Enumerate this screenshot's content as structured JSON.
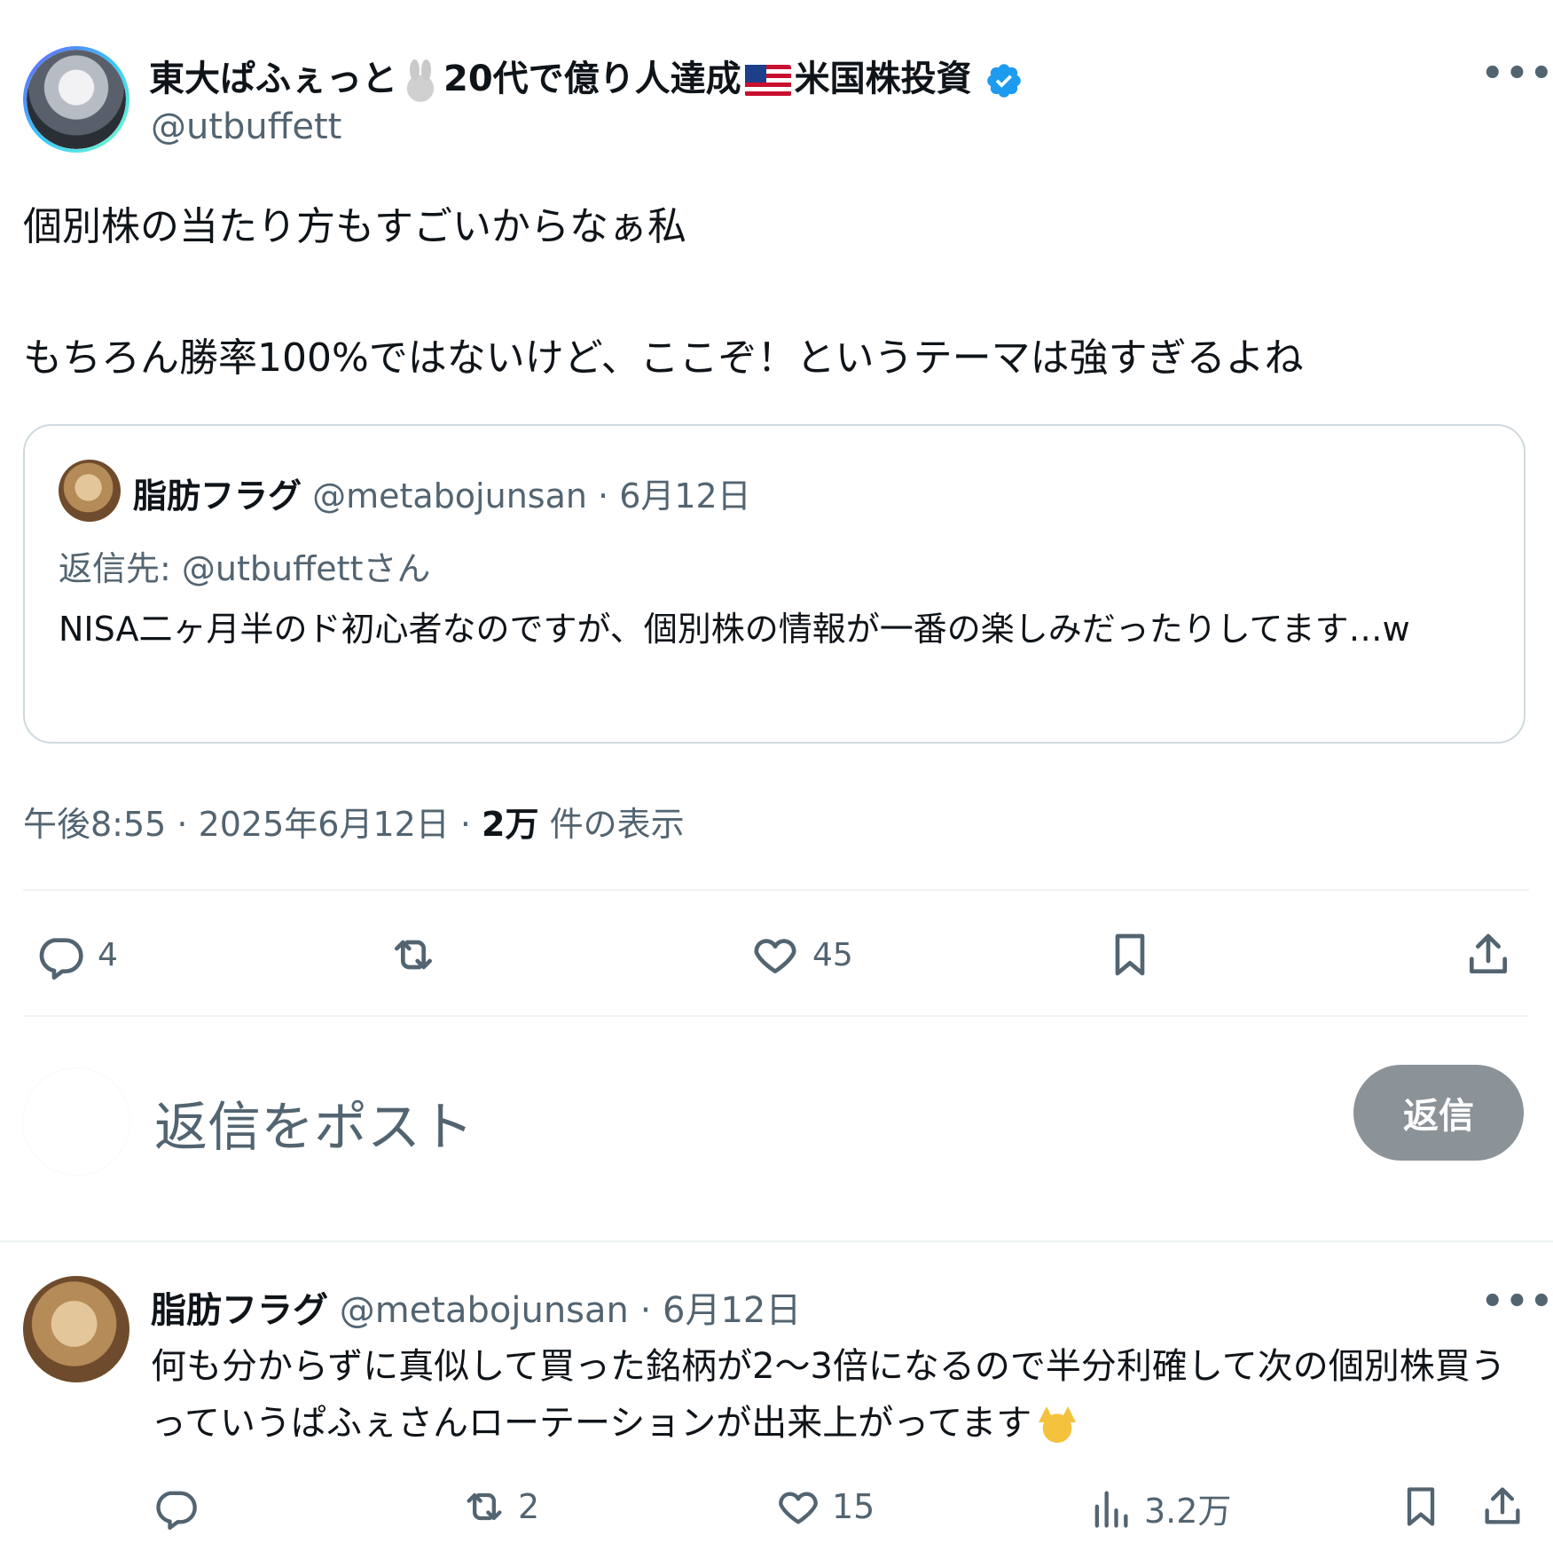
{
  "main_post": {
    "display_name": "東大ぱふぇっと",
    "display_name_mid": "20代で億り人達成",
    "display_name_end": "米国株投資",
    "handle": "@utbuffett",
    "line1": "個別株の当たり方もすごいからなぁ私",
    "line2": "もちろん勝率100%ではないけど、ここぞ！というテーマは強すぎるよね",
    "timestamp": "午後8:55 · 2025年6月12日 · ",
    "views_count": "2万",
    "views_label": " 件の表示",
    "replies": "4",
    "likes": "45"
  },
  "quoted": {
    "display_name": "脂肪フラグ",
    "meta": "@metabojunsan · 6月12日",
    "reply_to": "返信先: @utbuffettさん",
    "text": "NISA二ヶ月半のド初心者なのですが、個別株の情報が一番の楽しみだったりしてます…w"
  },
  "composer": {
    "placeholder": "返信をポスト",
    "button": "返信"
  },
  "reply_post": {
    "display_name": "脂肪フラグ",
    "meta": "@metabojunsan · 6月12日",
    "text": "何も分からずに真似して買った銘柄が2〜3倍になるので半分利確して次の個別株買うっていうぱふぇさんローテーションが出来上がってます",
    "retweets": "2",
    "likes": "15",
    "views": "3.2万"
  },
  "colors": {
    "verified": "#1d9bf0",
    "secondary_text": "#536471",
    "divider": "#eff3f4"
  }
}
